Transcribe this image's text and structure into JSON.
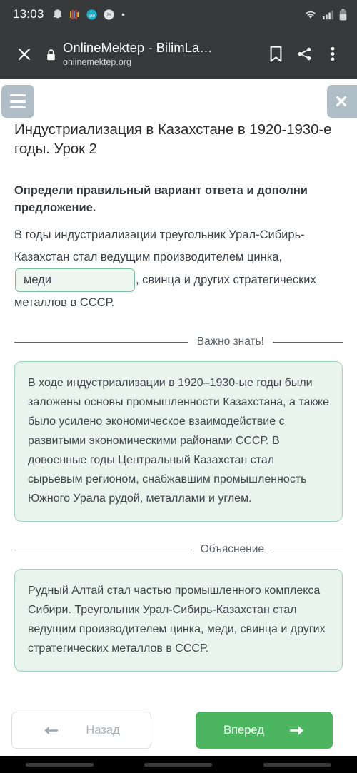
{
  "status_bar": {
    "time": "13:03",
    "notification_icons": [
      "ghost-icon",
      "equalizer-icon",
      "app-circle-icon",
      "shazam-icon",
      "dot-icon"
    ],
    "right_icons": [
      "wifi-icon",
      "signal-icon",
      "battery-icon"
    ]
  },
  "browser": {
    "close_icon": "close-icon",
    "lock_icon": "lock-icon",
    "title": "OnlineMektep - BilimLa…",
    "url": "onlinemektep.org",
    "bookmark_icon": "bookmark-icon",
    "share_icon": "share-icon",
    "menu_icon": "overflow-menu-icon"
  },
  "page": {
    "menu_icon": "hamburger-menu-icon",
    "close_icon": "close-icon",
    "lesson_title": "Индустриализация в Казахстане в 1920-1930-е годы. Урок 2",
    "prompt": "Определи правильный вариант ответа и дополни предложение.",
    "sentence_part1": "В годы индустриализации треугольник Урал-Сибирь-Казахстан стал ведущим производителем цинка, ",
    "answer_value": "меди",
    "answer_placeholder": "",
    "sentence_part2": ", свинца и других стратегических металлов в СССР."
  },
  "important_section": {
    "divider_label": "Важно знать!",
    "body": "В ходе индустриализации в 1920–1930-ые годы были заложены основы промышленности Казахстана, а также было усилено экономическое взаимодействие с развитыми экономическими районами СССР. В довоенные годы Центральный Казахстан стал сырьевым регионом, снабжавшим промышленность Южного Урала рудой, металлами и углем."
  },
  "explanation_section": {
    "divider_label": "Объяснение",
    "body": "Рудный Алтай стал частью промышленного комплекса Сибири. Треугольник Урал-Сибирь-Казахстан стал ведущим производителем цинка, меди, свинца и других стратегических металлов в СССР."
  },
  "navigation": {
    "back_label": "Назад",
    "back_icon": "arrow-left-icon",
    "forward_label": "Вперед",
    "forward_icon": "arrow-right-icon"
  },
  "colors": {
    "accent_green": "#4cb55f",
    "card_bg": "#e9f4ee",
    "card_border": "#9fd3bb",
    "chrome_bg": "#37393b",
    "button_gray_blue": "#aebdc6"
  }
}
